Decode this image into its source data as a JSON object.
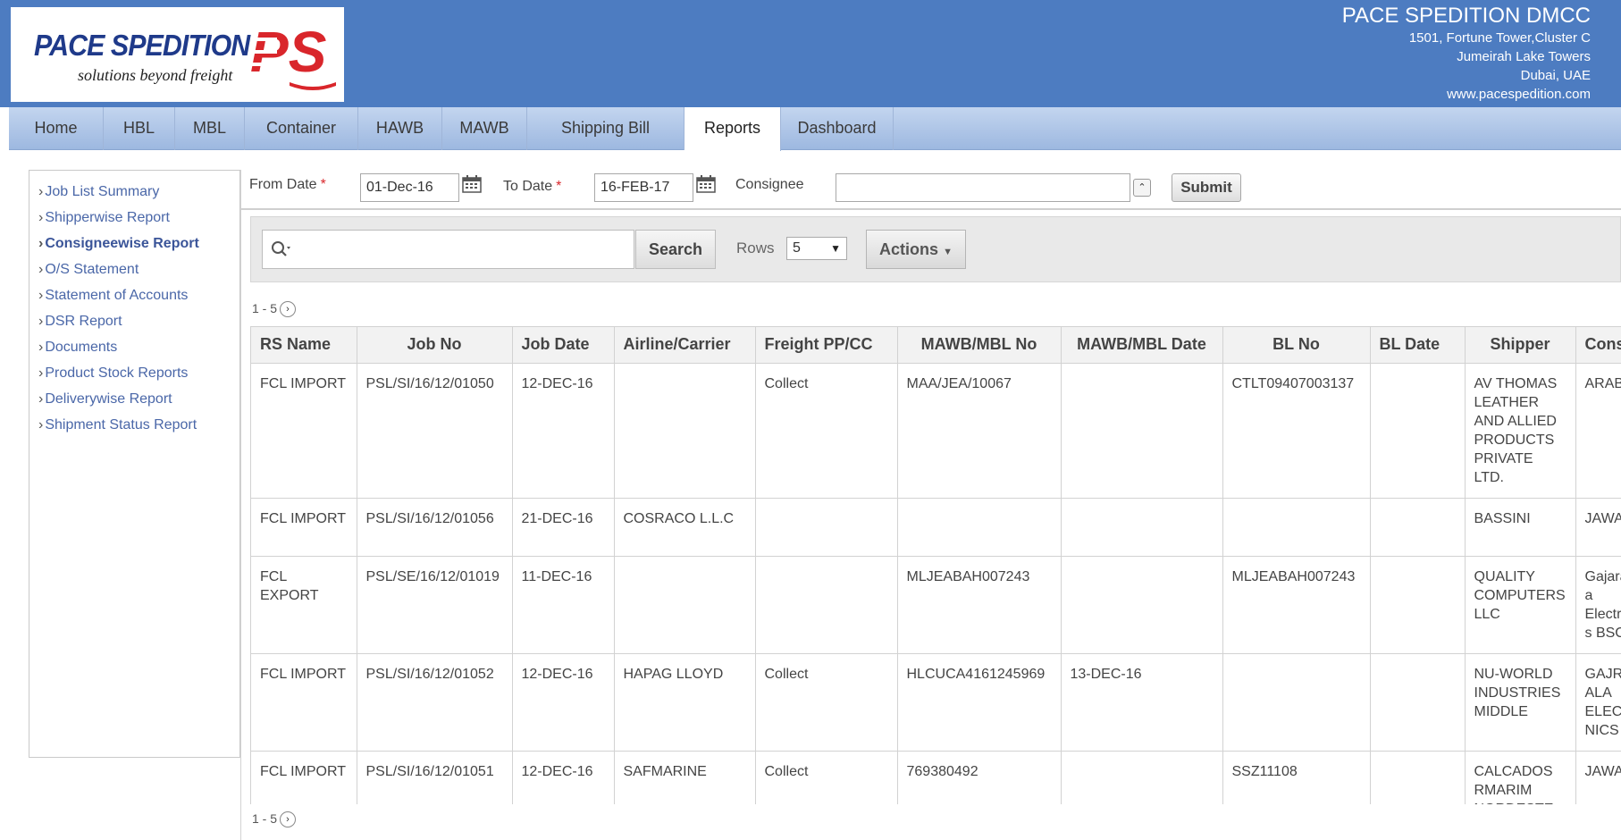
{
  "brand": {
    "logo_main": "PACE SPEDITION",
    "logo_tagline": "solutions beyond freight",
    "logo_mark": "PS",
    "company_name": "PACE SPEDITION DMCC",
    "address_lines": [
      "1501, Fortune Tower,Cluster C",
      "Jumeirah Lake Towers",
      "Dubai, UAE",
      "www.pacespedition.com"
    ],
    "colors": {
      "header": "#4d7cc1",
      "logo_blue": "#1f3a8a",
      "logo_red": "#d9262b"
    }
  },
  "nav": {
    "tabs": [
      {
        "label": "Home",
        "active": false
      },
      {
        "label": "HBL",
        "active": false
      },
      {
        "label": "MBL",
        "active": false
      },
      {
        "label": "Container",
        "active": false
      },
      {
        "label": "HAWB",
        "active": false
      },
      {
        "label": "MAWB",
        "active": false
      },
      {
        "label": "Shipping Bill",
        "active": false
      },
      {
        "label": "Reports",
        "active": true
      },
      {
        "label": "Dashboard",
        "active": false
      }
    ]
  },
  "sidebar": {
    "items": [
      {
        "label": "Job List Summary",
        "current": false
      },
      {
        "label": "Shipperwise Report",
        "current": false
      },
      {
        "label": "Consigneewise Report",
        "current": true
      },
      {
        "label": "O/S Statement",
        "current": false
      },
      {
        "label": "Statement of Accounts",
        "current": false
      },
      {
        "label": "DSR Report",
        "current": false
      },
      {
        "label": "Documents",
        "current": false
      },
      {
        "label": "Product Stock Reports",
        "current": false
      },
      {
        "label": "Deliverywise Report",
        "current": false
      },
      {
        "label": "Shipment Status Report",
        "current": false
      }
    ]
  },
  "filters": {
    "from_date_label": "From Date",
    "from_date_value": "01-Dec-16",
    "to_date_label": "To Date",
    "to_date_value": "16-FEB-17",
    "required_mark": "*",
    "consignee_label": "Consignee",
    "consignee_value": "",
    "submit_label": "Submit"
  },
  "report": {
    "search_placeholder": "",
    "search_button": "Search",
    "rows_label": "Rows",
    "rows_value": "5",
    "actions_label": "Actions",
    "pagination": "1 - 5",
    "columns": [
      "RS Name",
      "Job No",
      "Job Date",
      "Airline/Carrier",
      "Freight PP/CC",
      "MAWB/MBL No",
      "MAWB/MBL Date",
      "BL No",
      "BL Date",
      "Shipper",
      "Consignee"
    ],
    "rows": [
      [
        "FCL IMPORT",
        "PSL/SI/16/12/01050",
        "12-DEC-16",
        "",
        "Collect",
        "MAA/JEA/10067",
        "",
        "CTLT09407003137",
        "",
        "AV THOMAS LEATHER AND ALLIED PRODUCTS PRIVATE LTD.",
        "ARABIAN"
      ],
      [
        "FCL IMPORT",
        "PSL/SI/16/12/01056",
        "21-DEC-16",
        "COSRACO L.L.C",
        "",
        "",
        "",
        "",
        "",
        "BASSINI",
        "JAWAD"
      ],
      [
        "FCL EXPORT",
        "PSL/SE/16/12/01019",
        "11-DEC-16",
        "",
        "",
        "MLJEABAH007243",
        "",
        "MLJEABAH007243",
        "",
        "QUALITY COMPUTERS LLC",
        "Gajarawala Electronics BSC"
      ],
      [
        "FCL IMPORT",
        "PSL/SI/16/12/01052",
        "12-DEC-16",
        "HAPAG LLOYD",
        "Collect",
        "HLCUCA4161245969",
        "13-DEC-16",
        "",
        "",
        "NU-WORLD INDUSTRIES MIDDLE",
        "GAJRAWALA ELECTRONICS"
      ],
      [
        "FCL IMPORT",
        "PSL/SI/16/12/01051",
        "12-DEC-16",
        "SAFMARINE",
        "Collect",
        "769380492",
        "",
        "SSZ11108",
        "",
        "CALCADOS RMARIM NORDESTE LTDA",
        "JAWAD"
      ]
    ]
  }
}
